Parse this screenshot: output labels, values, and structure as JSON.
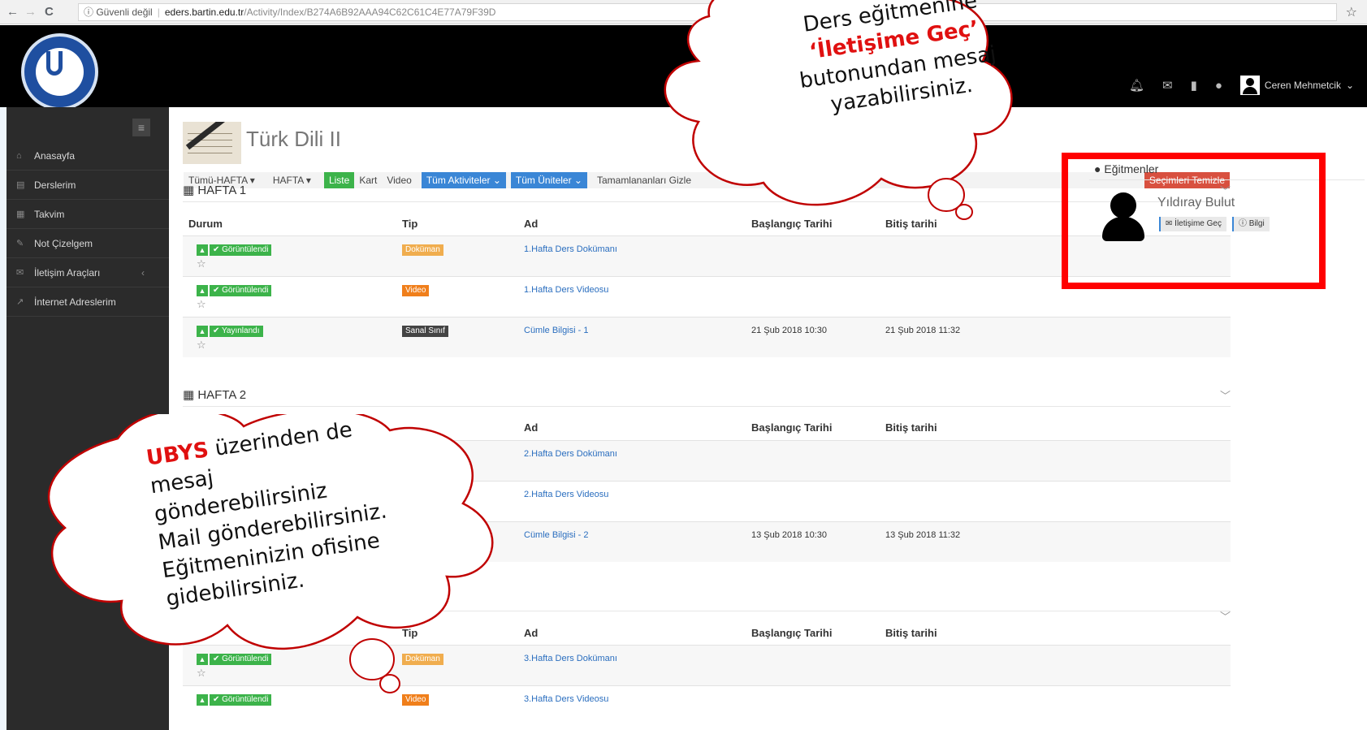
{
  "browser": {
    "back": "←",
    "forward": "→",
    "reload": "C",
    "security": "ⓘ Güvenli değil",
    "host": "eders.bartin.edu.tr",
    "path": "/Activity/Index/B274A6B92AAA94C62C61C4E77A79F39D",
    "bookmark_icon": "star-icon"
  },
  "header": {
    "logo_icon": "university-seal-icon",
    "icons": [
      "bell-icon",
      "envelope-icon",
      "book-icon",
      "globe-icon"
    ],
    "user_name": "Ceren Mehmetcik"
  },
  "sidebar": {
    "items": [
      {
        "label": "Anasayfa",
        "icon": "home-icon"
      },
      {
        "label": "Derslerim",
        "icon": "book-icon"
      },
      {
        "label": "Takvim",
        "icon": "calendar-icon"
      },
      {
        "label": "Not Çizelgem",
        "icon": "pencil-icon"
      },
      {
        "label": "İletişim Araçları",
        "icon": "envelope-icon"
      },
      {
        "label": "İnternet Adreslerim",
        "icon": "external-link-icon"
      }
    ]
  },
  "course": {
    "title": "Türk Dili II"
  },
  "filters": {
    "week_all": "Tümü-HAFTA ▾",
    "week": "HAFTA ▾",
    "view_list": "Liste",
    "view_card": "Kart",
    "view_video": "Video",
    "activities": "Tüm Aktiviteler ⌄",
    "units": "Tüm Üniteler ⌄",
    "hide_completed": "Tamamlananları Gizle",
    "clear": "Seçimleri Temizle"
  },
  "table": {
    "headers": {
      "status": "Durum",
      "type": "Tip",
      "name": "Ad",
      "start": "Başlangıç Tarihi",
      "end": "Bitiş tarihi"
    }
  },
  "weeks": [
    {
      "title": "HAFTA 1",
      "rows": [
        {
          "status": "✔ Görüntülendi",
          "type": "Doküman",
          "name": "1.Hafta Ders Dokümanı",
          "start": "",
          "end": ""
        },
        {
          "status": "✔ Görüntülendi",
          "type": "Video",
          "name": "1.Hafta Ders Videosu",
          "start": "",
          "end": ""
        },
        {
          "status": "✔ Yayınlandı",
          "type": "Sanal Sınıf",
          "name": "Cümle Bilgisi - 1",
          "start": "21 Şub 2018 10:30",
          "end": "21 Şub 2018 11:32"
        }
      ]
    },
    {
      "title": "HAFTA 2",
      "rows": [
        {
          "name": "2.Hafta Ders Dokümanı"
        },
        {
          "name": "2.Hafta Ders Videosu"
        },
        {
          "name": "Cümle Bilgisi - 2",
          "start": "13 Şub 2018 10:30",
          "end": "13 Şub 2018 11:32"
        }
      ]
    },
    {
      "rows": [
        {
          "status": "✔ Görüntülendi",
          "type": "Doküman",
          "name": "3.Hafta Ders Dokümanı"
        },
        {
          "status": "✔ Görüntülendi",
          "type": "Video",
          "name": "3.Hafta Ders Videosu"
        }
      ]
    }
  ],
  "instructors": {
    "title": "Eğitmenler",
    "name": "Yıldıray Bulut",
    "contact_btn": "İletişime Geç",
    "info_btn": "Bilgi"
  },
  "callout_top": {
    "line1": "Ders eğitmenine",
    "line2": "‘İletişime Geç’",
    "line3": "butonundan mesaj",
    "line4": "yazabilirsiniz."
  },
  "callout_bottom": {
    "highlight": "UBYS",
    "line1_rest": " üzerinden de",
    "line2": "mesaj",
    "line3": "gönderebilirsiniz",
    "line4": "Mail gönderebilirsiniz.",
    "line5": "Eğitmeninizin ofisine",
    "line6": "gidebilirsiniz."
  },
  "colors": {
    "header_bg": "#000000",
    "sidebar_bg": "#2b2b2b",
    "accent_blue": "#3a86d6",
    "accent_green": "#3cb34a",
    "accent_red": "#d8503f",
    "frame_red": "#ff0000",
    "link_blue": "#2a6ebf"
  }
}
